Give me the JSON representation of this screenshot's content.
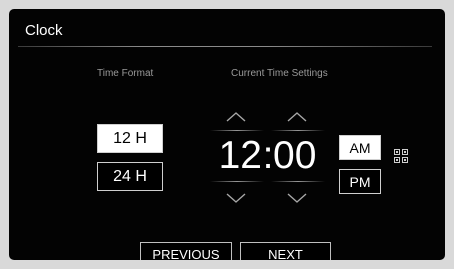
{
  "header": {
    "title": "Clock"
  },
  "time_format": {
    "label": "Time Format",
    "options": [
      "12 H",
      "24 H"
    ],
    "selected": "12 H"
  },
  "current_time_settings": {
    "label": "Current Time Settings",
    "hour": "12",
    "separator": ":",
    "minute": "00",
    "meridiem_options": [
      "AM",
      "PM"
    ],
    "meridiem_selected": "AM"
  },
  "icons": {
    "hour_up": "chevron-up-icon",
    "hour_down": "chevron-down-icon",
    "minute_up": "chevron-up-icon",
    "minute_down": "chevron-down-icon",
    "extra": "grid-icon"
  },
  "footer": {
    "previous_label": "PREVIOUS",
    "next_label": "NEXT"
  },
  "colors": {
    "background": "#030303",
    "selected_fill": "#ffffff",
    "text": "#ffffff",
    "muted_text": "#9a9a9a"
  }
}
